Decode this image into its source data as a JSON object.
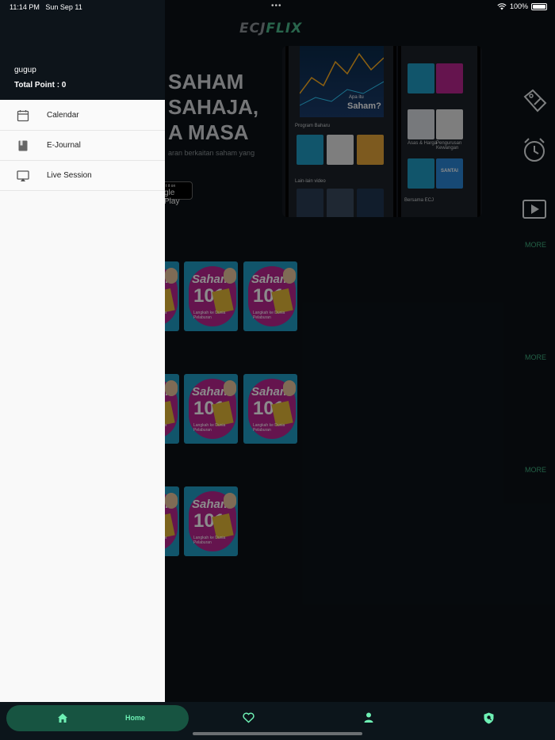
{
  "status_bar": {
    "time": "11:14 PM",
    "date": "Sun Sep 11",
    "dots": "•••",
    "battery": "100%"
  },
  "header": {
    "logo_part1": "ECJ",
    "logo_part2": "FLIX"
  },
  "hero": {
    "line1": "SAHAM",
    "line2": "SAHAJA,",
    "line3": "A MASA",
    "subtitle": "aran berkaitan saham yang",
    "store_small": "t it on",
    "store_big": "gle Play"
  },
  "mockup": {
    "chart_small": "Apa itu",
    "chart_text": "Saham?",
    "program_label": "Program Baharu",
    "lain_label": "Lain-lain video",
    "bersama_label": "Bersama ECJ",
    "kewangan_label": "Pengurusan Kewangan",
    "harga_label": "Asas & Harga",
    "santai_label": "SANTAI"
  },
  "sections": [
    {
      "more": "MORE",
      "card_title_1": "Saham",
      "card_title_2": "101",
      "card_caption": "Langkah ke Dunia Pelaburan"
    },
    {
      "more": "MORE",
      "card_title_1": "Saham",
      "card_title_2": "101",
      "card_caption": "Langkah ke Dunia Pelaburan"
    },
    {
      "more": "MORE",
      "card_title_1": "Saham",
      "card_title_2": "101",
      "card_caption": "Langkah ke Dunia Pelaburan"
    }
  ],
  "drawer": {
    "user_name": "gugup",
    "points": "Total Point : 0",
    "items": [
      {
        "label": "Calendar",
        "icon": "calendar-icon"
      },
      {
        "label": "E-Journal",
        "icon": "journal-icon"
      },
      {
        "label": "Live Session",
        "icon": "airplay-icon"
      }
    ]
  },
  "bottom_nav": {
    "home_label": "Home",
    "items": [
      "home-icon",
      "heart-icon",
      "person-icon",
      "shield-icon"
    ]
  },
  "colors": {
    "accent": "#3fae7f",
    "nav_active_bg": "#175441",
    "nav_active_text": "#6ef0b4",
    "card_pink": "#b8258f",
    "card_blue": "#1f9bc4"
  }
}
